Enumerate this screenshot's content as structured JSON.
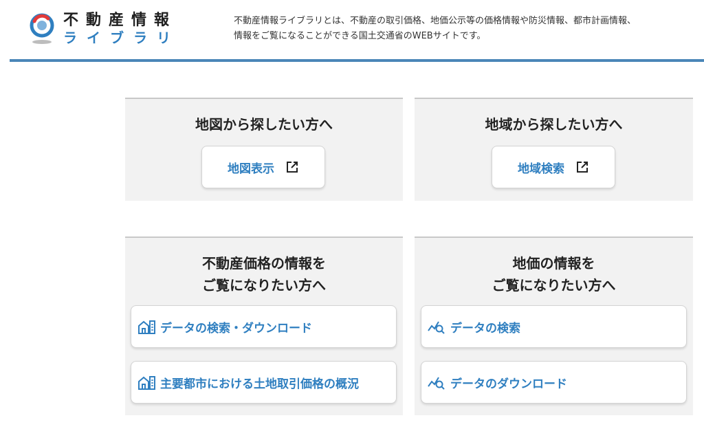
{
  "header": {
    "logo_line1": "不動産情報",
    "logo_line2": "ライブラリ",
    "description_line1": "不動産情報ライブラリとは、不動産の取引価格、地価公示等の価格情報や防災情報、都市計画情報、",
    "description_line2": "情報をご覧になることができる国土交通省のWEBサイトです。"
  },
  "panels": {
    "map": {
      "title": "地図から探したい方へ",
      "button_label": "地図表示"
    },
    "region": {
      "title": "地域から探したい方へ",
      "button_label": "地域検索"
    },
    "realestate_price": {
      "title_line1": "不動産価格の情報を",
      "title_line2": "ご覧になりたい方へ",
      "buttons": [
        {
          "label": "データの検索・ダウンロード"
        },
        {
          "label": "主要都市における土地取引価格の概況"
        }
      ]
    },
    "land_price": {
      "title_line1": "地価の情報を",
      "title_line2": "ご覧になりたい方へ",
      "buttons": [
        {
          "label": "データの検索"
        },
        {
          "label": "データのダウンロード"
        }
      ]
    }
  },
  "colors": {
    "accent": "#2f7fc0",
    "header_rule": "#4a86b8",
    "panel_bg": "#f2f2f2"
  },
  "icons": {
    "logo": "mlit-logo-icon",
    "external_link": "external-link-icon",
    "building": "building-icon",
    "chart_search": "chart-search-icon"
  }
}
